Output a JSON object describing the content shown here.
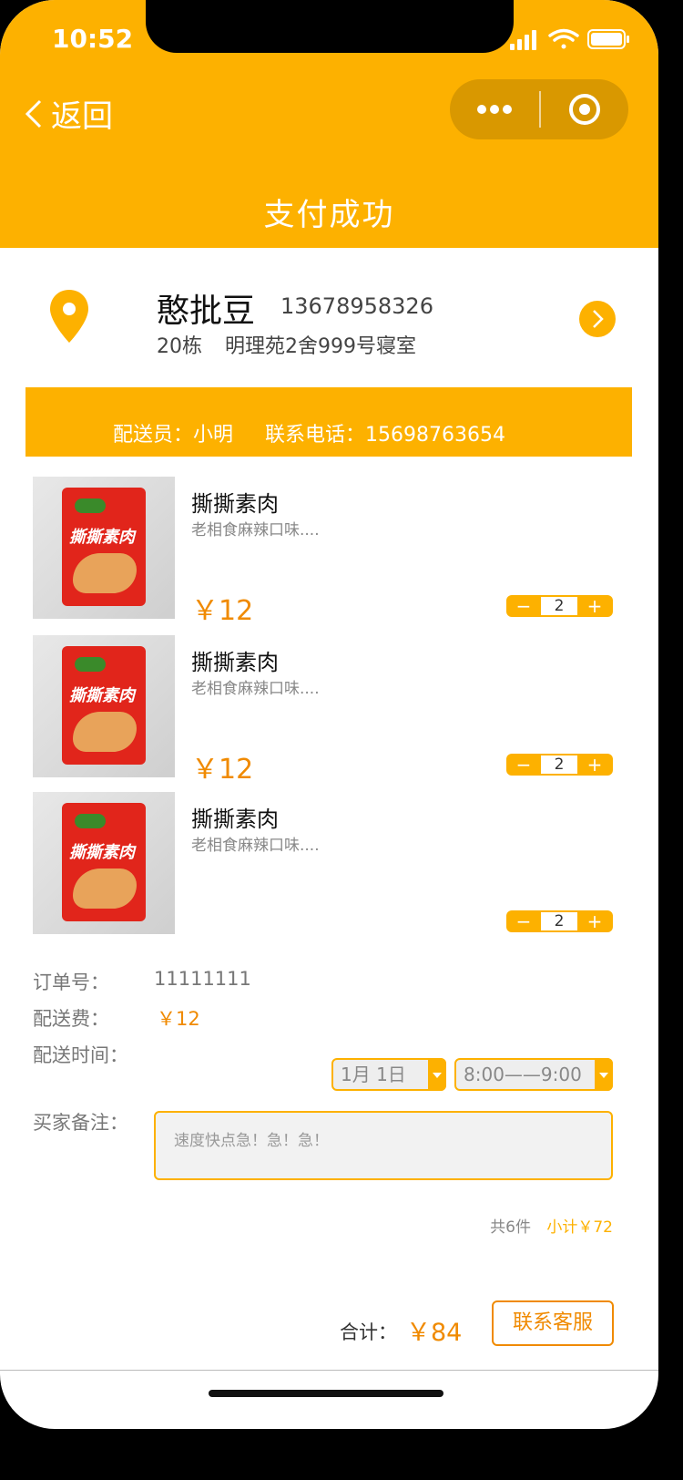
{
  "status_bar": {
    "time": "10:52"
  },
  "nav": {
    "back_label": "返回",
    "title": "支付成功"
  },
  "address": {
    "name": "憨批豆",
    "phone": "13678958326",
    "building": "20栋",
    "detail": "明理苑2舍999号寝室"
  },
  "courier": {
    "label": "配送员：小明",
    "phone_label": "联系电话：15698763654"
  },
  "items": [
    {
      "name": "撕撕素肉",
      "desc": "老相食麻辣口味....",
      "price": "￥12",
      "qty": "2",
      "pack_brand": "撕撕素肉"
    },
    {
      "name": "撕撕素肉",
      "desc": "老相食麻辣口味....",
      "price": "￥12",
      "qty": "2",
      "pack_brand": "撕撕素肉"
    },
    {
      "name": "撕撕素肉",
      "desc": "老相食麻辣口味....",
      "price": "",
      "qty": "2",
      "pack_brand": "撕撕素肉"
    }
  ],
  "stepper": {
    "minus": "−",
    "plus": "+"
  },
  "order": {
    "order_no_label": "订单号：",
    "order_no": "11111111",
    "fee_label": "配送费：",
    "fee": "￥12",
    "time_label": "配送时间：",
    "date_value": "1月  1日",
    "time_value": "8:00——9:00",
    "remark_label": "买家备注：",
    "remark_text": "速度快点急！急！急！"
  },
  "summary": {
    "count": "共6件",
    "subtotal": "小计￥72"
  },
  "footer": {
    "total_label": "合计：",
    "total": "￥84",
    "contact_button": "联系客服"
  },
  "colors": {
    "accent": "#FDB100",
    "price": "#F08A00"
  }
}
